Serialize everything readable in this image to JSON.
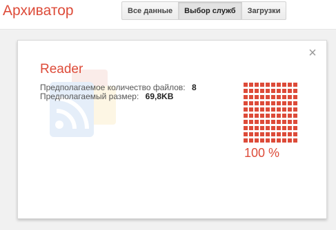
{
  "app": {
    "title": "Архиватор"
  },
  "tabs": [
    {
      "label": "Все данные",
      "active": false
    },
    {
      "label": "Выбор служб",
      "active": true
    },
    {
      "label": "Загрузки",
      "active": false
    }
  ],
  "card": {
    "service_name": "Reader",
    "close_icon": "close-icon",
    "watermark_icon": "reader-logo-icon",
    "stats": [
      {
        "label": "Предполагаемое количество файлов:",
        "value": "8"
      },
      {
        "label": "Предполагаемый размер:",
        "value": "69,8KB"
      }
    ],
    "progress": {
      "fraction": 1.0,
      "label": "100 %"
    }
  },
  "colors": {
    "accent": "#dd4b39",
    "text": "#555555"
  }
}
